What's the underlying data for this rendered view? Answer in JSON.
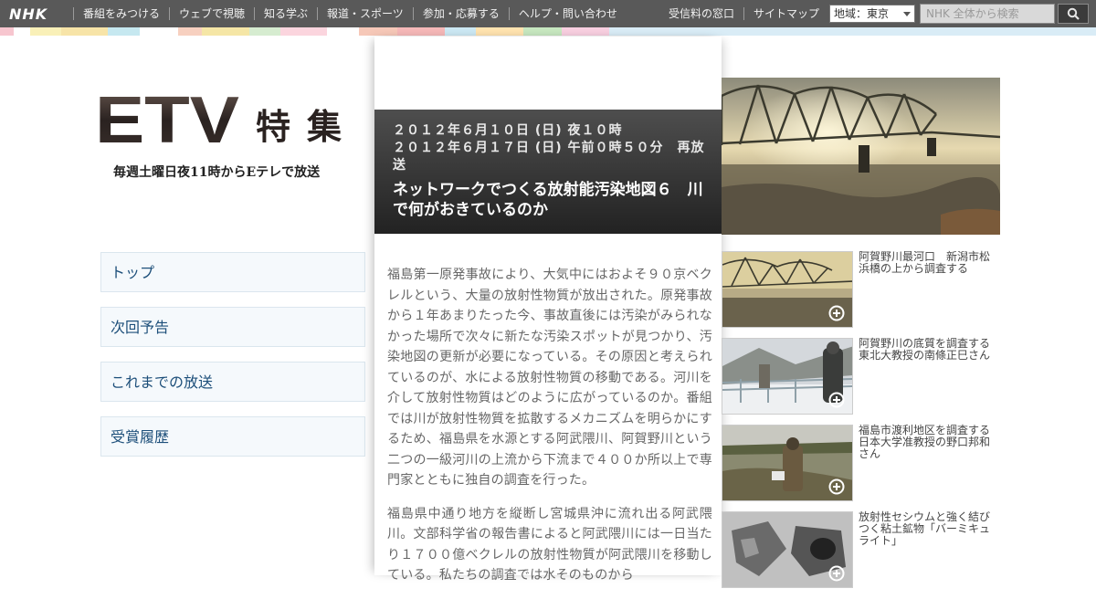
{
  "header": {
    "logo": "NHK",
    "nav": [
      "番組をみつける",
      "ウェブで視聴",
      "知る学ぶ",
      "報道・スポーツ",
      "参加・応募する",
      "ヘルプ・問い合わせ"
    ],
    "nav_right": [
      "受信料の窓口",
      "サイトマップ"
    ],
    "region": "地域：東京",
    "search_placeholder": "NHK 全体から検索"
  },
  "stripe_colors": [
    "#f7c6cf",
    "#ffffff",
    "#f9f0b8",
    "#f7e4a8",
    "#c6e8f0",
    "#ffffff",
    "#f7d0c0",
    "#f5e6a6",
    "#d6ecd0",
    "#fbd5de",
    "#ffffff",
    "#f6c8b8",
    "#f5b8b8",
    "#cce8f3",
    "#ffe3b0",
    "#c7e7c0",
    "#f8cfe0",
    "#d9ecf6"
  ],
  "program": {
    "title": "ETV 特 集",
    "schedule": "毎週土曜日夜11時からEテレで放送"
  },
  "menu": [
    "トップ",
    "次回予告",
    "これまでの放送",
    "受賞履歴"
  ],
  "episode": {
    "air1": "２０１２年６月１０日 (日) 夜１０時",
    "air2": "２０１２年６月１７日 (日) 午前０時５０分　再放送",
    "title": "ネットワークでつくる放射能汚染地図６　川で何がおきているのか",
    "paragraph1": "福島第一原発事故により、大気中にはおよそ９０京ベクレルという、大量の放射性物質が放出された。原発事故から１年あまりたった今、事故直後には汚染がみられなかった場所で次々に新たな汚染スポットが見つかり、汚染地図の更新が必要になっている。その原因と考えられているのが、水による放射性物質の移動である。河川を介して放射性物質はどのように広がっているのか。番組では川が放射性物質を拡散するメカニズムを明らかにするため、福島県を水源とする阿武隈川、阿賀野川という二つの一級河川の上流から下流まで４００か所以上で専門家とともに独自の調査を行った。",
    "paragraph2": "福島県中通り地方を縦断し宮城県沖に流れ出る阿武隈川。文部科学省の報告書によると阿武隈川には一日当たり１７００億ベクレルの放射性物質が阿武隈川を移動している。私たちの調査では水そのものから"
  },
  "photos": [
    {
      "caption": "阿賀野川最河口　新潟市松浜橋の上から調査する"
    },
    {
      "caption": "阿賀野川の底質を調査する東北大教授の南條正巳さん"
    },
    {
      "caption": "福島市渡利地区を調査する日本大学准教授の野口邦和さん"
    },
    {
      "caption": "放射性セシウムと強く結びつく粘土鉱物「バーミキュライト」"
    }
  ]
}
